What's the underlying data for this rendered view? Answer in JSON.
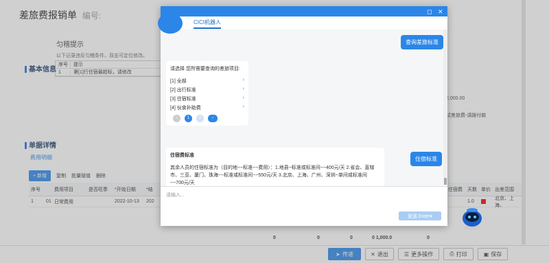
{
  "app": {
    "title": "差旅费报销单",
    "title_suffix": "编号:"
  },
  "hint": {
    "title": "匀稽提示",
    "desc": "以下记录违反匀稽条件，双击可定位修改。",
    "col_no": "序号",
    "col_hint": "提示",
    "rows": [
      {
        "no": "1",
        "text": "第[1]行住宿最超标，请修改"
      }
    ]
  },
  "sections": {
    "basic": "基本信息",
    "detail": "单据详情",
    "fee_tab": "费用明细"
  },
  "toolbar": {
    "new": "+ 新增",
    "copy": "复制",
    "batch": "批量赋值",
    "delete": "删除"
  },
  "grid": {
    "headers": [
      "序号",
      "",
      "费用项目",
      "是否旺季",
      "*开始日期",
      "*结",
      "住宿费",
      "天数",
      "单价",
      "出差范围"
    ],
    "rows": [
      {
        "no": "1",
        "code": "01",
        "item": "日常费用",
        "start": "2022-10-13",
        "end": "202",
        "days": "1.0",
        "place": "北京、上海、"
      }
    ],
    "sum": [
      "0",
      "0",
      "0",
      "0 1,000.0",
      "0"
    ],
    "side_texts": [
      "2,000.00",
      "试差旅费-调拨付款"
    ]
  },
  "footer": {
    "pass": "传递",
    "exit": "退出",
    "more": "更多操作",
    "print": "打印",
    "save": "保存"
  },
  "dialog": {
    "tab": "CICI机器人",
    "btn_query": "查询差旅标准",
    "card_title": "请选择 您所需要查询的差旅项目:",
    "options": [
      "[1] 全部",
      "[2] 出行标准",
      "[3] 住宿标准",
      "[4] 伙食补助费"
    ],
    "pages": [
      "‹",
      "1",
      "2",
      "›"
    ],
    "btn_stay": "住宿标准",
    "answer_title": "住宿费标准",
    "answer_body": "其余人员的住宿标准为（目的地~~标准~~费用）：1.地县~标准或标准间~~400元/天 2.省会、直辖市、三亚、厦门、珠海~~标准或标准间~~550元/天 3.北京、上海、广州、深圳~单间或标准间~~700元/天",
    "input_placeholder": "请输入...",
    "send": "发送 Enter",
    "colors": {
      "primary": "#2b86e8",
      "warning": "#e00000"
    }
  }
}
